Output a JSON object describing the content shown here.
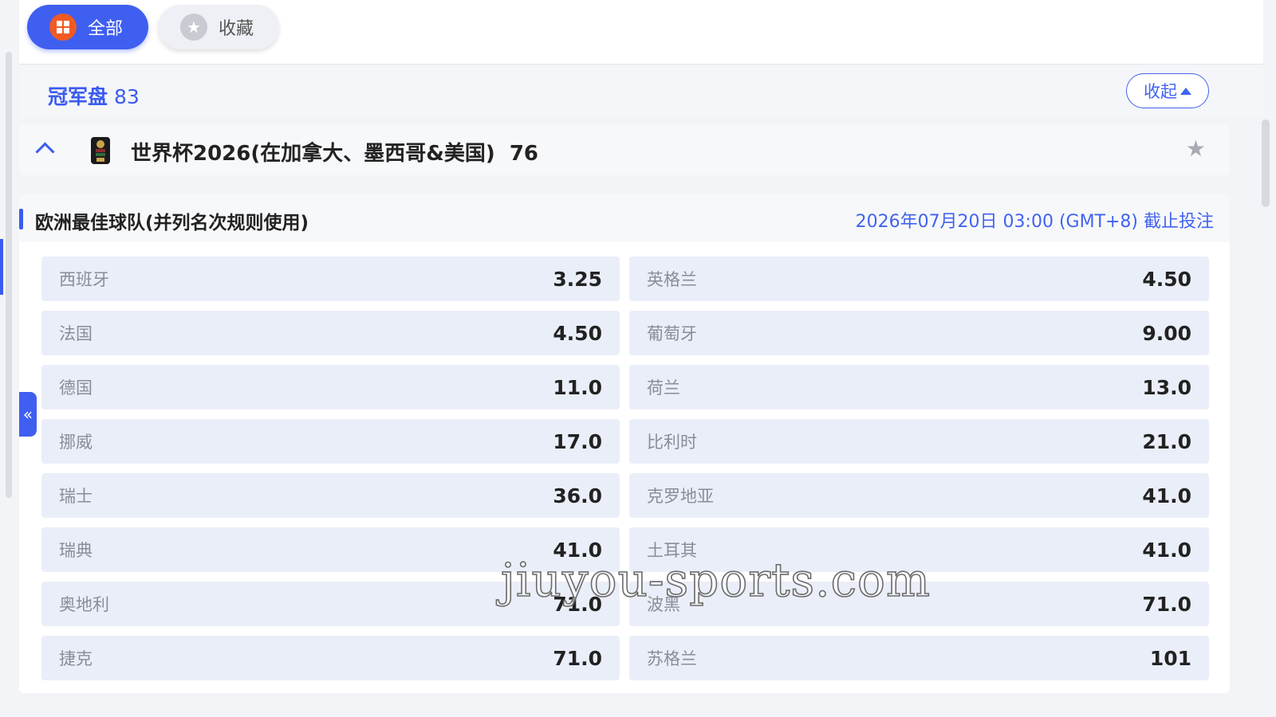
{
  "tabs": [
    {
      "label": "全部",
      "icon": "grid-icon",
      "active": true
    },
    {
      "label": "收藏",
      "icon": "star-icon",
      "active": false
    }
  ],
  "section": {
    "title": "冠军盘",
    "count": "83",
    "collapse_label": "收起"
  },
  "league": {
    "name": "世界杯2026(在加拿大、墨西哥&美国)",
    "count": "76"
  },
  "market": {
    "title": "欧洲最佳球队(并列名次规则使用)",
    "deadline": "2026年07月20日 03:00 (GMT+8) 截止投注"
  },
  "selections": [
    {
      "team": "西班牙",
      "odds": "3.25"
    },
    {
      "team": "英格兰",
      "odds": "4.50"
    },
    {
      "team": "法国",
      "odds": "4.50"
    },
    {
      "team": "葡萄牙",
      "odds": "9.00"
    },
    {
      "team": "德国",
      "odds": "11.0"
    },
    {
      "team": "荷兰",
      "odds": "13.0"
    },
    {
      "team": "挪威",
      "odds": "17.0"
    },
    {
      "team": "比利时",
      "odds": "21.0"
    },
    {
      "team": "瑞士",
      "odds": "36.0"
    },
    {
      "team": "克罗地亚",
      "odds": "41.0"
    },
    {
      "team": "瑞典",
      "odds": "41.0"
    },
    {
      "team": "土耳其",
      "odds": "41.0"
    },
    {
      "team": "奥地利",
      "odds": "71.0"
    },
    {
      "team": "波黑",
      "odds": "71.0"
    },
    {
      "team": "捷克",
      "odds": "71.0"
    },
    {
      "team": "苏格兰",
      "odds": "101"
    }
  ],
  "side_tab_glyph": "«",
  "watermark": "jiuyou-sports.com",
  "colors": {
    "accent": "#3f5ff1",
    "orange": "#f15a24",
    "cell_bg": "#eaeef8"
  }
}
